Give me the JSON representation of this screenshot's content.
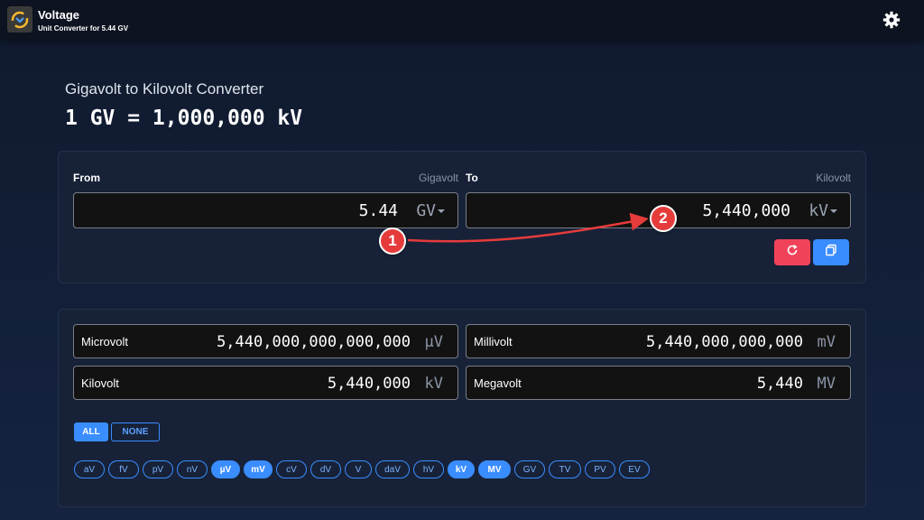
{
  "app": {
    "name": "Voltage",
    "subtitle": "Unit Converter for 5.44 GV",
    "icon": "convert-icon",
    "settings_icon": "gear-icon"
  },
  "page": {
    "title": "Gigavolt to Kilovolt Converter",
    "formula": "1 GV = 1,000,000 kV"
  },
  "converter": {
    "from": {
      "label": "From",
      "unit_name": "Gigavolt",
      "value": "5.44",
      "unit": "GV"
    },
    "to": {
      "label": "To",
      "unit_name": "Kilovolt",
      "value": "5,440,000",
      "unit": "kV"
    },
    "reset_icon": "refresh-icon",
    "copy_icon": "copy-icon"
  },
  "results": [
    {
      "name": "Microvolt",
      "value": "5,440,000,000,000,000",
      "unit": "µV"
    },
    {
      "name": "Millivolt",
      "value": "5,440,000,000,000",
      "unit": "mV"
    },
    {
      "name": "Kilovolt",
      "value": "5,440,000",
      "unit": "kV"
    },
    {
      "name": "Megavolt",
      "value": "5,440",
      "unit": "MV"
    }
  ],
  "filters": {
    "all_label": "ALL",
    "none_label": "NONE",
    "chips": [
      {
        "label": "aV",
        "active": false
      },
      {
        "label": "fV",
        "active": false
      },
      {
        "label": "pV",
        "active": false
      },
      {
        "label": "nV",
        "active": false
      },
      {
        "label": "µV",
        "active": true
      },
      {
        "label": "mV",
        "active": true
      },
      {
        "label": "cV",
        "active": false
      },
      {
        "label": "dV",
        "active": false
      },
      {
        "label": "V",
        "active": false
      },
      {
        "label": "daV",
        "active": false
      },
      {
        "label": "hV",
        "active": false
      },
      {
        "label": "kV",
        "active": true
      },
      {
        "label": "MV",
        "active": true
      },
      {
        "label": "GV",
        "active": false
      },
      {
        "label": "TV",
        "active": false
      },
      {
        "label": "PV",
        "active": false
      },
      {
        "label": "EV",
        "active": false
      }
    ]
  },
  "annotations": {
    "step1": "1",
    "step2": "2",
    "color": "#e63b3b"
  },
  "colors": {
    "accent": "#3a8dff",
    "danger": "#f0435a",
    "background": "#152341"
  }
}
